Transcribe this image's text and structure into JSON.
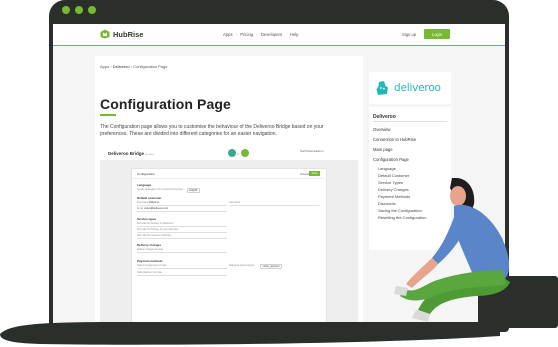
{
  "header": {
    "brand": "HubRise",
    "nav": [
      "Apps",
      "·",
      "Pricing",
      "·",
      "Developers",
      "·",
      "Help"
    ],
    "signup": "Sign up",
    "login": "Login"
  },
  "breadcrumb": {
    "items": [
      "Apps",
      "›",
      "Deliveroo",
      "›",
      "Configuration Page"
    ]
  },
  "doc": {
    "title": "Configuration Page",
    "intro": "The Configuration page allows you to customise the behaviour of the Deliveroo Bridge based on your preferences. These are divided into different categories for an easier navigation."
  },
  "screenshot": {
    "app_title": "Deliveroo Bridge",
    "app_version": "by hubrise",
    "store_line1": "Test Pizza location 1",
    "store_line2": "·",
    "panel_label": "Configuration",
    "cancel": "Cancel",
    "save": "Save",
    "sections": {
      "language": "Language",
      "language_row": "Set the language in the customer's browser",
      "language_value": "English",
      "default_customer": "Default customer",
      "first_name": "First name",
      "first_name_value": "Deliveroo",
      "last_name": "Last name",
      "email": "Email",
      "email_value": "orders@deliveroo.com",
      "service_types": "Service types",
      "st_row1": "Ref code for Delivery by Deliveroo",
      "st_row2": "Ref code for Delivery by your own fleet",
      "st_row3": "Ref code for customer collection",
      "delivery_charges": "Delivery charges",
      "dc_row1": "Delivery charge ref code",
      "payment_methods": "Payment methods",
      "pm_row1": "Deliveroo payment ref code",
      "pm_row2": "Deliveroo payment type",
      "pm_row2_value": "online_payment",
      "pm_row3": "Cash payment ref code"
    }
  },
  "sidebar": {
    "logo_text": "deliveroo",
    "toc_title": "Deliveroo",
    "items": [
      "Overview",
      "Connection to HubRise",
      "Main page",
      "Configuration Page"
    ],
    "subitems": [
      "Language",
      "Default Customer",
      "Service Types",
      "Delivery Charges",
      "Payment Methods",
      "Discounts",
      "Saving the Configuration",
      "Resetting the Configuration"
    ]
  },
  "colors": {
    "accent": "#78b832",
    "frame": "#2b2f2b",
    "deliveroo": "#22b8b6",
    "shirt": "#5a86c9",
    "pants": "#4e9a34",
    "hair": "#1e1e1e"
  }
}
